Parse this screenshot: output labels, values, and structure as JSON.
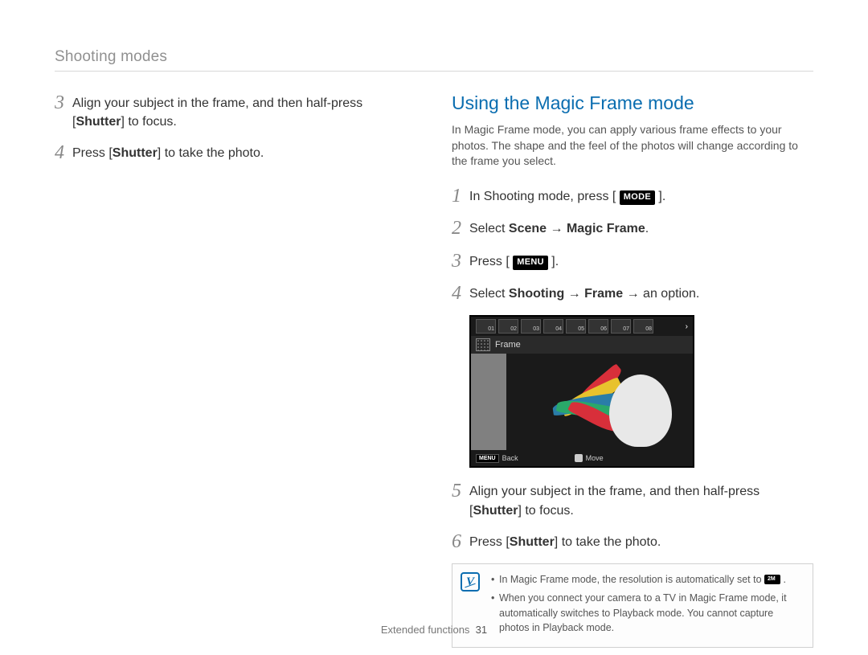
{
  "header": {
    "title": "Shooting modes"
  },
  "left": {
    "steps": [
      {
        "num": "3",
        "html": "Align your subject in the frame, and then half-press [<b>Shutter</b>] to focus."
      },
      {
        "num": "4",
        "html": "Press [<b>Shutter</b>] to take the photo."
      }
    ]
  },
  "right": {
    "title": "Using the Magic Frame mode",
    "intro": "In Magic Frame mode, you can apply various frame effects to your photos. The shape and the feel of the photos will change according to the frame you select.",
    "steps_a": [
      {
        "num": "1",
        "html": "In Shooting mode, press [ <span class=\"mode-badge\">MODE</span> ]."
      },
      {
        "num": "2",
        "html": "Select <b>Scene</b> → <b>Magic Frame</b>."
      },
      {
        "num": "3",
        "html": "Press [ <span class=\"menu-badge\">MENU</span> ]."
      },
      {
        "num": "4",
        "html": "Select <b>Shooting</b> → <b>Frame</b> → an option."
      }
    ],
    "steps_b": [
      {
        "num": "5",
        "html": "Align your subject in the frame, and then half-press [<b>Shutter</b>] to focus."
      },
      {
        "num": "6",
        "html": "Press [<b>Shutter</b>] to take the photo."
      }
    ]
  },
  "camera": {
    "strip_labels": [
      "01",
      "02",
      "03",
      "04",
      "05",
      "06",
      "07",
      "08"
    ],
    "frame_label": "Frame",
    "back_badge": "MENU",
    "back_text": "Back",
    "move_text": "Move"
  },
  "notes": {
    "items": [
      "In Magic Frame mode, the resolution is automatically set to <span class=\"res-badge\"></span> .",
      "When you connect your camera to a TV in Magic Frame mode, it automatically switches to Playback mode. You cannot capture photos in Playback mode."
    ]
  },
  "footer": {
    "section": "Extended functions",
    "page": "31"
  }
}
